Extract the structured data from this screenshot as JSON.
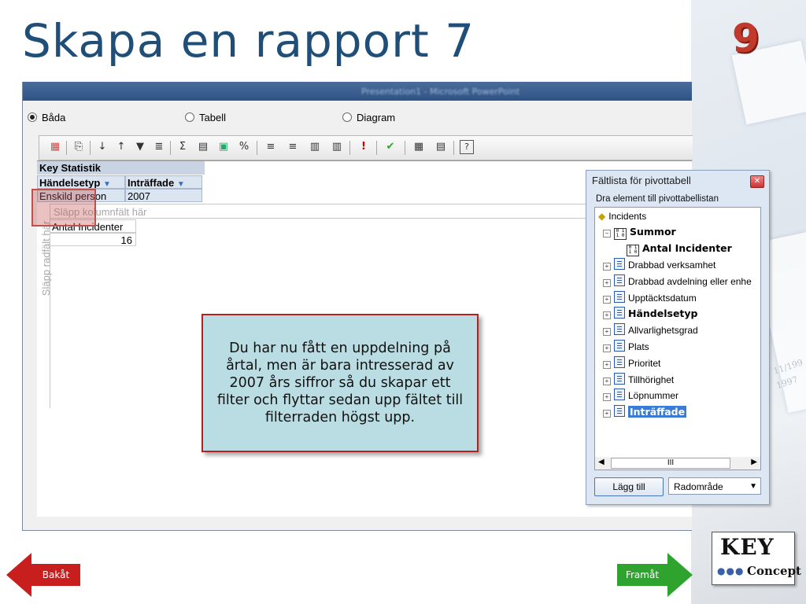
{
  "slide": {
    "title": "Skapa en rapport 7",
    "number": "9"
  },
  "window": {
    "title": "Presentation1 - Microsoft PowerPoint"
  },
  "view_options": [
    {
      "label": "Båda",
      "selected": true
    },
    {
      "label": "Tabell",
      "selected": false
    },
    {
      "label": "Diagram",
      "selected": false
    }
  ],
  "toolbar_icons": [
    "pivot-icon",
    "copy-icon",
    "sort-asc-icon",
    "sort-desc-icon",
    "filter-icon",
    "show-top-icon",
    "autosum-icon",
    "subtotal-icon",
    "calculated-icon",
    "percent-icon",
    "collapse-icon",
    "expand-icon",
    "hide-details-icon",
    "show-details-icon",
    "exclamation-icon",
    "export-icon",
    "field-list-icon",
    "properties-icon",
    "help-icon"
  ],
  "pivot": {
    "title": "Key Statistik",
    "row_field": "Händelsetyp",
    "column_field": "Inträffade",
    "row_value": "Enskild person",
    "column_value": "2007",
    "drop_column_hint": "Släpp kolumnfält här",
    "drop_row_hint": "Släpp radfält här",
    "data_header": "Antal Incidenter",
    "data_value": "16"
  },
  "callout": {
    "text": "Du har nu fått en uppdelning på årtal, men är bara intresserad av 2007 års siffror så du skapar ett filter och flyttar sedan upp fältet till filterraden högst upp."
  },
  "field_list": {
    "title": "Fältlista för pivottabell",
    "instruction": "Dra element till pivottabellistan",
    "root": "Incidents",
    "summary_group": "Summor",
    "summary_item": "Antal Incidenter",
    "fields": [
      {
        "label": "Drabbad verksamhet",
        "bold": false,
        "selected": false
      },
      {
        "label": "Drabbad avdelning eller enhe",
        "bold": false,
        "selected": false
      },
      {
        "label": "Upptäcktsdatum",
        "bold": false,
        "selected": false
      },
      {
        "label": "Händelsetyp",
        "bold": true,
        "selected": false
      },
      {
        "label": "Allvarlighetsgrad",
        "bold": false,
        "selected": false
      },
      {
        "label": "Plats",
        "bold": false,
        "selected": false
      },
      {
        "label": "Prioritet",
        "bold": false,
        "selected": false
      },
      {
        "label": "Tillhörighet",
        "bold": false,
        "selected": false
      },
      {
        "label": "Löpnummer",
        "bold": false,
        "selected": false
      },
      {
        "label": "Inträffade",
        "bold": true,
        "selected": true
      }
    ],
    "scroll_thumb": "III",
    "add_button": "Lägg till",
    "area_select": "Radområde"
  },
  "nav": {
    "back": "Bakåt",
    "next": "Framåt"
  },
  "logo": {
    "line1": "KEY",
    "line2": "Concept"
  }
}
